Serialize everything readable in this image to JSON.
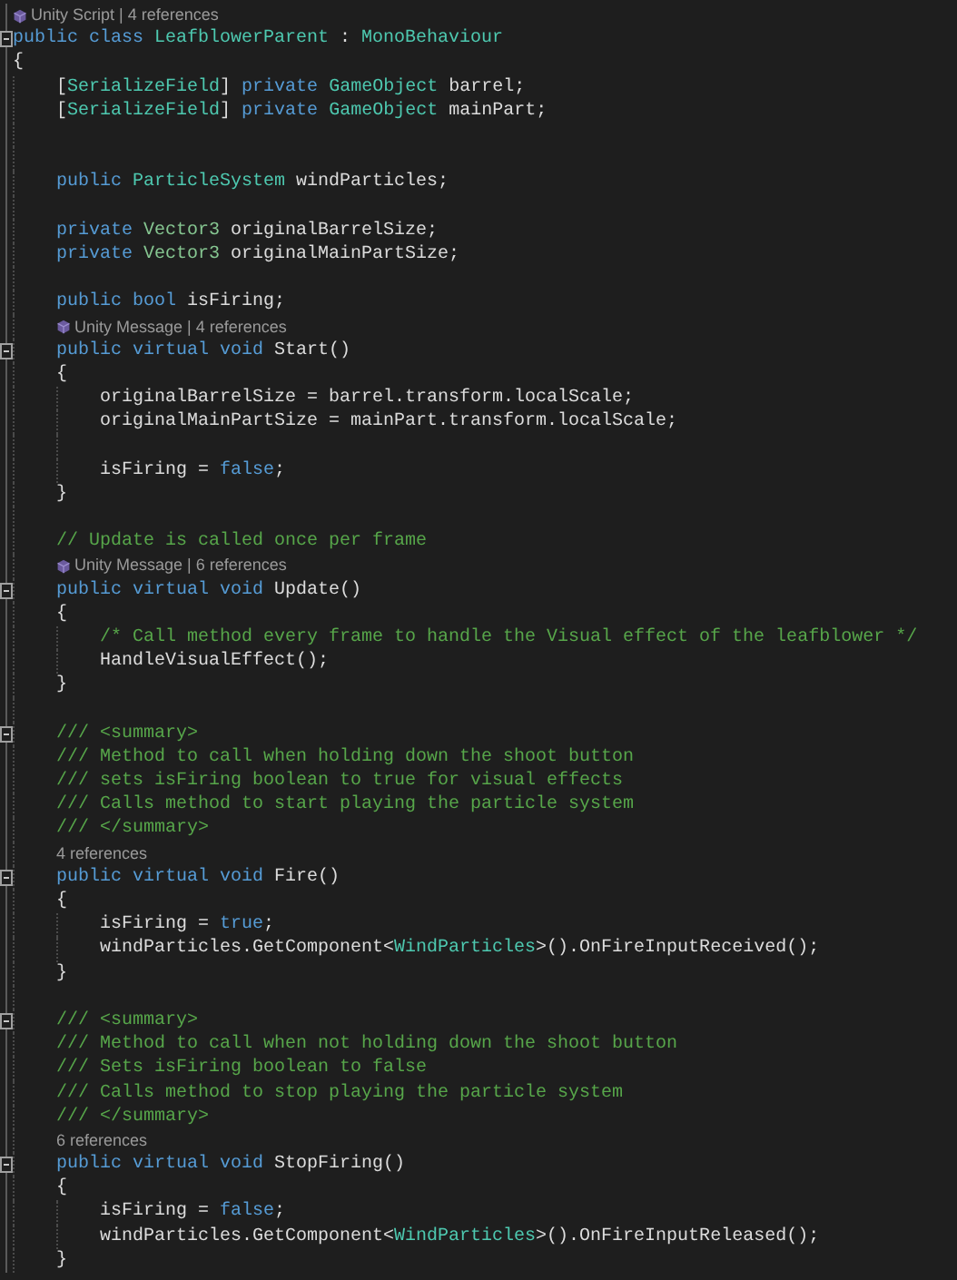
{
  "editor": {
    "lines": [
      {
        "kind": "unity_lens",
        "text": "Unity Script | 4 references"
      },
      {
        "kind": "code",
        "fold": true,
        "tokens": [
          {
            "kind": "keyword",
            "text": "public class "
          },
          {
            "kind": "type",
            "text": "LeafblowerParent"
          },
          {
            "kind": "plain",
            "text": " : "
          },
          {
            "kind": "type",
            "text": "MonoBehaviour"
          }
        ]
      },
      {
        "kind": "code",
        "tokens": [
          {
            "kind": "plain",
            "text": "{"
          }
        ],
        "children": [
          {
            "kind": "code",
            "tokens": [
              {
                "kind": "plain",
                "text": "["
              },
              {
                "kind": "type",
                "text": "SerializeField"
              },
              {
                "kind": "plain",
                "text": "] "
              },
              {
                "kind": "keyword",
                "text": "private "
              },
              {
                "kind": "type",
                "text": "GameObject"
              },
              {
                "kind": "plain",
                "text": " barrel;"
              }
            ]
          },
          {
            "kind": "code",
            "tokens": [
              {
                "kind": "plain",
                "text": "["
              },
              {
                "kind": "type",
                "text": "SerializeField"
              },
              {
                "kind": "plain",
                "text": "] "
              },
              {
                "kind": "keyword",
                "text": "private "
              },
              {
                "kind": "type",
                "text": "GameObject"
              },
              {
                "kind": "plain",
                "text": " mainPart;"
              }
            ]
          },
          {
            "kind": "blank"
          },
          {
            "kind": "blank"
          },
          {
            "kind": "code",
            "tokens": [
              {
                "kind": "keyword",
                "text": "public "
              },
              {
                "kind": "type",
                "text": "ParticleSystem"
              },
              {
                "kind": "plain",
                "text": " windParticles;"
              }
            ]
          },
          {
            "kind": "blank"
          },
          {
            "kind": "code",
            "tokens": [
              {
                "kind": "keyword",
                "text": "private "
              },
              {
                "kind": "struct",
                "text": "Vector3"
              },
              {
                "kind": "plain",
                "text": " originalBarrelSize;"
              }
            ]
          },
          {
            "kind": "code",
            "tokens": [
              {
                "kind": "keyword",
                "text": "private "
              },
              {
                "kind": "struct",
                "text": "Vector3"
              },
              {
                "kind": "plain",
                "text": " originalMainPartSize;"
              }
            ]
          },
          {
            "kind": "blank"
          },
          {
            "kind": "code",
            "tokens": [
              {
                "kind": "keyword",
                "text": "public bool "
              },
              {
                "kind": "plain",
                "text": "isFiring;"
              }
            ]
          },
          {
            "kind": "unity_lens",
            "text": "Unity Message | 4 references"
          },
          {
            "kind": "code",
            "fold": true,
            "tokens": [
              {
                "kind": "keyword",
                "text": "public virtual void "
              },
              {
                "kind": "plain",
                "text": "Start()"
              }
            ]
          },
          {
            "kind": "code",
            "tokens": [
              {
                "kind": "plain",
                "text": "{"
              }
            ],
            "children": [
              {
                "kind": "code",
                "tokens": [
                  {
                    "kind": "plain",
                    "text": "originalBarrelSize = barrel.transform.localScale;"
                  }
                ]
              },
              {
                "kind": "code",
                "tokens": [
                  {
                    "kind": "plain",
                    "text": "originalMainPartSize = mainPart.transform.localScale;"
                  }
                ]
              },
              {
                "kind": "blank"
              },
              {
                "kind": "code",
                "tokens": [
                  {
                    "kind": "plain",
                    "text": "isFiring = "
                  },
                  {
                    "kind": "keyword",
                    "text": "false"
                  },
                  {
                    "kind": "plain",
                    "text": ";"
                  }
                ]
              }
            ]
          },
          {
            "kind": "code",
            "tokens": [
              {
                "kind": "plain",
                "text": "}"
              }
            ]
          },
          {
            "kind": "blank"
          },
          {
            "kind": "code",
            "tokens": [
              {
                "kind": "comment",
                "text": "// Update is called once per frame"
              }
            ]
          },
          {
            "kind": "unity_lens",
            "text": "Unity Message | 6 references"
          },
          {
            "kind": "code",
            "fold": true,
            "tokens": [
              {
                "kind": "keyword",
                "text": "public virtual void "
              },
              {
                "kind": "plain",
                "text": "Update()"
              }
            ]
          },
          {
            "kind": "code",
            "tokens": [
              {
                "kind": "plain",
                "text": "{"
              }
            ],
            "children": [
              {
                "kind": "code",
                "tokens": [
                  {
                    "kind": "comment",
                    "text": "/* Call method every frame to handle the Visual effect of the leafblower */"
                  }
                ]
              },
              {
                "kind": "code",
                "tokens": [
                  {
                    "kind": "plain",
                    "text": "HandleVisualEffect();"
                  }
                ]
              }
            ]
          },
          {
            "kind": "code",
            "tokens": [
              {
                "kind": "plain",
                "text": "}"
              }
            ]
          },
          {
            "kind": "blank"
          },
          {
            "kind": "code",
            "fold": true,
            "tokens": [
              {
                "kind": "comment",
                "text": "/// <summary>"
              }
            ]
          },
          {
            "kind": "code",
            "tokens": [
              {
                "kind": "comment",
                "text": "/// Method to call when holding down the shoot button"
              }
            ]
          },
          {
            "kind": "code",
            "tokens": [
              {
                "kind": "comment",
                "text": "/// sets isFiring boolean to true for visual effects"
              }
            ]
          },
          {
            "kind": "code",
            "tokens": [
              {
                "kind": "comment",
                "text": "/// Calls method to start playing the particle system"
              }
            ]
          },
          {
            "kind": "code",
            "tokens": [
              {
                "kind": "comment",
                "text": "/// </summary>"
              }
            ]
          },
          {
            "kind": "lens",
            "text": "4 references"
          },
          {
            "kind": "code",
            "fold": true,
            "tokens": [
              {
                "kind": "keyword",
                "text": "public virtual void "
              },
              {
                "kind": "plain",
                "text": "Fire()"
              }
            ]
          },
          {
            "kind": "code",
            "tokens": [
              {
                "kind": "plain",
                "text": "{"
              }
            ],
            "children": [
              {
                "kind": "code",
                "tokens": [
                  {
                    "kind": "plain",
                    "text": "isFiring = "
                  },
                  {
                    "kind": "keyword",
                    "text": "true"
                  },
                  {
                    "kind": "plain",
                    "text": ";"
                  }
                ]
              },
              {
                "kind": "code",
                "tokens": [
                  {
                    "kind": "plain",
                    "text": "windParticles.GetComponent<"
                  },
                  {
                    "kind": "type",
                    "text": "WindParticles"
                  },
                  {
                    "kind": "plain",
                    "text": ">().OnFireInputReceived();"
                  }
                ]
              }
            ]
          },
          {
            "kind": "code",
            "tokens": [
              {
                "kind": "plain",
                "text": "}"
              }
            ]
          },
          {
            "kind": "blank"
          },
          {
            "kind": "code",
            "fold": true,
            "tokens": [
              {
                "kind": "comment",
                "text": "/// <summary>"
              }
            ]
          },
          {
            "kind": "code",
            "tokens": [
              {
                "kind": "comment",
                "text": "/// Method to call when not holding down the shoot button"
              }
            ]
          },
          {
            "kind": "code",
            "tokens": [
              {
                "kind": "comment",
                "text": "/// Sets isFiring boolean to false"
              }
            ]
          },
          {
            "kind": "code",
            "tokens": [
              {
                "kind": "comment",
                "text": "/// Calls method to stop playing the particle system"
              }
            ]
          },
          {
            "kind": "code",
            "tokens": [
              {
                "kind": "comment",
                "text": "/// </summary>"
              }
            ]
          },
          {
            "kind": "lens",
            "text": "6 references"
          },
          {
            "kind": "code",
            "fold": true,
            "tokens": [
              {
                "kind": "keyword",
                "text": "public virtual void "
              },
              {
                "kind": "plain",
                "text": "StopFiring()"
              }
            ]
          },
          {
            "kind": "code",
            "tokens": [
              {
                "kind": "plain",
                "text": "{"
              }
            ],
            "children": [
              {
                "kind": "code",
                "tokens": [
                  {
                    "kind": "plain",
                    "text": "isFiring = "
                  },
                  {
                    "kind": "keyword",
                    "text": "false"
                  },
                  {
                    "kind": "plain",
                    "text": ";"
                  }
                ]
              },
              {
                "kind": "code",
                "tokens": [
                  {
                    "kind": "plain",
                    "text": "windParticles.GetComponent<"
                  },
                  {
                    "kind": "type",
                    "text": "WindParticles"
                  },
                  {
                    "kind": "plain",
                    "text": ">().OnFireInputReleased();"
                  }
                ]
              }
            ]
          },
          {
            "kind": "code",
            "tokens": [
              {
                "kind": "plain",
                "text": "}"
              }
            ]
          }
        ]
      }
    ]
  }
}
